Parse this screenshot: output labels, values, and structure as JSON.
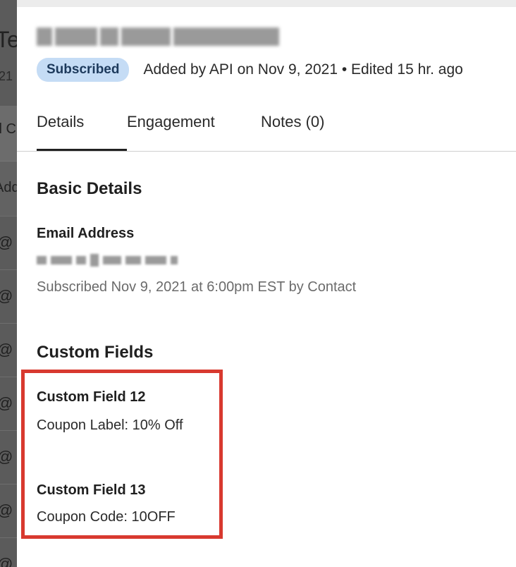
{
  "background": {
    "title_fragment": "Te",
    "sub_fragment": "21",
    "header_fragment": "ll C",
    "header2_fragment": "Add",
    "row_fragment": "@"
  },
  "contact": {
    "status_badge": "Subscribed",
    "meta": "Added by API on Nov 9, 2021 • Edited 15 hr. ago"
  },
  "tabs": [
    {
      "label": "Details",
      "active": true
    },
    {
      "label": "Engagement",
      "active": false
    },
    {
      "label": "Notes (0)",
      "active": false
    }
  ],
  "basic_details": {
    "title": "Basic Details",
    "email_label": "Email Address",
    "subscription_info": "Subscribed Nov 9, 2021 at 6:00pm EST by Contact"
  },
  "custom_fields": {
    "title": "Custom Fields",
    "fields": [
      {
        "name": "Custom Field 12",
        "value": "Coupon Label: 10% Off"
      },
      {
        "name": "Custom Field 13",
        "value": "Coupon Code: 10OFF"
      }
    ]
  },
  "colors": {
    "badge_bg": "#c5dcf5",
    "highlight": "#d8392f",
    "overlay": "#555555"
  }
}
